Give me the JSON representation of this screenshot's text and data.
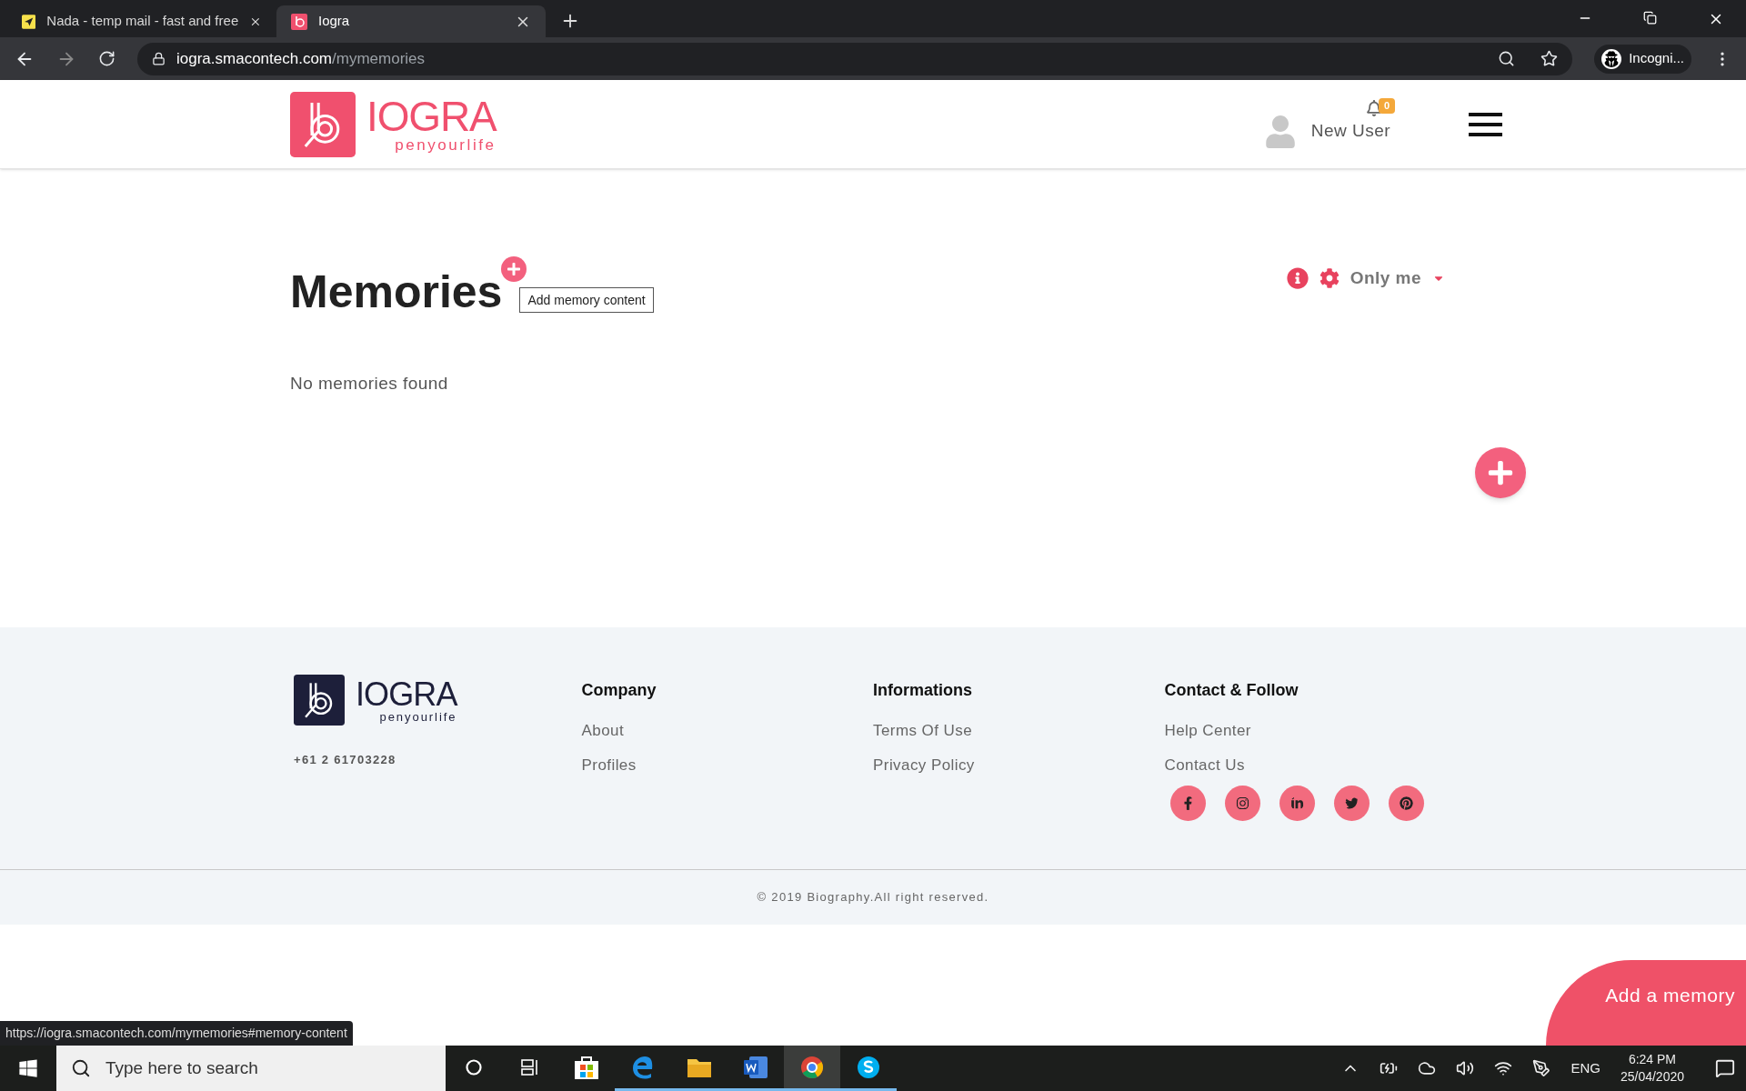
{
  "browser": {
    "tabs": [
      {
        "title": "Nada - temp mail - fast and free",
        "kind": "mail",
        "selected": false
      },
      {
        "title": "Iogra",
        "kind": "site",
        "selected": true
      }
    ],
    "url": {
      "host": "iogra.smacontech.com",
      "path": "/mymemories"
    },
    "profile": "Incogni..."
  },
  "header": {
    "logo": {
      "name": "IOGRA",
      "tagline": "penyourlife"
    },
    "notifications": "0",
    "user": "New User"
  },
  "main": {
    "title": "Memories",
    "tooltip": "Add memory content",
    "privacy": "Only me",
    "empty": "No memories found"
  },
  "footer": {
    "logo": {
      "name": "IOGRA",
      "tagline": "penyourlife"
    },
    "phone": "+61 2 61703228",
    "columns": [
      {
        "heading": "Company",
        "links": [
          "About",
          "Profiles"
        ]
      },
      {
        "heading": "Informations",
        "links": [
          "Terms Of Use",
          "Privacy Policy"
        ]
      },
      {
        "heading": "Contact & Follow",
        "links": [
          "Help Center",
          "Contact Us"
        ]
      }
    ],
    "socials": [
      {
        "kind": "facebook"
      },
      {
        "kind": "instagram"
      },
      {
        "kind": "linkedin"
      },
      {
        "kind": "twitter"
      },
      {
        "kind": "pinterest"
      }
    ],
    "copyright": "© 2019 Biography.All right reserved."
  },
  "add_memory": "Add a memory",
  "status_url": "https://iogra.smacontech.com/mymemories#memory-content",
  "taskbar": {
    "search": {
      "placeholder": "Type here to search"
    },
    "apps": [
      {
        "kind": "cortana",
        "running": false,
        "selected": false
      },
      {
        "kind": "taskview",
        "running": false,
        "selected": false
      },
      {
        "kind": "store",
        "running": false,
        "selected": false
      },
      {
        "kind": "edge",
        "running": true,
        "selected": false
      },
      {
        "kind": "explorer",
        "running": true,
        "selected": false
      },
      {
        "kind": "word",
        "running": true,
        "selected": false
      },
      {
        "kind": "chrome",
        "running": true,
        "selected": true
      },
      {
        "kind": "skype",
        "running": true,
        "selected": false
      }
    ],
    "language": "ENG",
    "time": "6:24 PM",
    "date": "25/04/2020"
  }
}
